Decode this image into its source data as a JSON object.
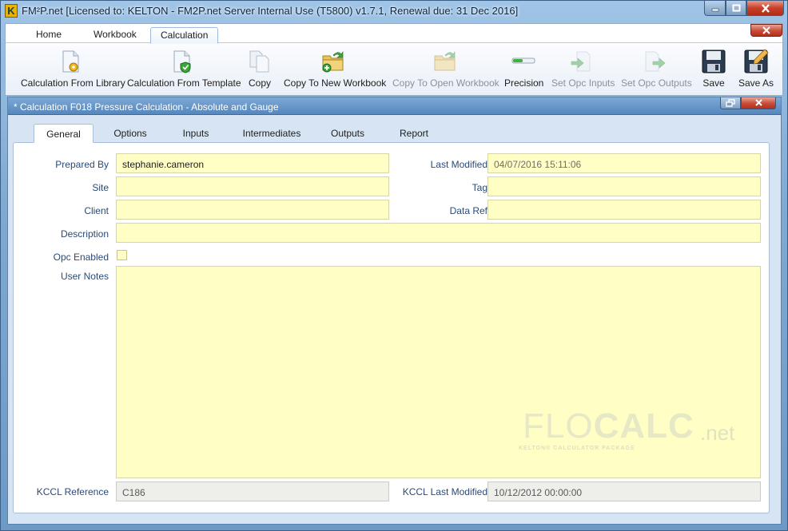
{
  "window": {
    "title": "FM²P.net [Licensed to: KELTON - FM2P.net Server Internal Use (T5800) v1.7.1, Renewal due: 31 Dec 2016]",
    "logo_letter": "K"
  },
  "ribbon": {
    "tabs": [
      "Home",
      "Workbook",
      "Calculation"
    ],
    "active_tab": "Calculation",
    "tools": [
      {
        "label": "Calculation From Library",
        "icon": "page-gear-icon",
        "enabled": true
      },
      {
        "label": "Calculation From Template",
        "icon": "page-check-icon",
        "enabled": true
      },
      {
        "label": "Copy",
        "icon": "copy-icon",
        "enabled": true
      },
      {
        "label": "Copy To New Workbook",
        "icon": "folder-add-icon",
        "enabled": true
      },
      {
        "label": "Copy To Open Workbook",
        "icon": "folder-arrow-icon",
        "enabled": false
      },
      {
        "label": "Precision",
        "icon": "precision-bar-icon",
        "enabled": true
      },
      {
        "label": "Set Opc Inputs",
        "icon": "opc-inputs-icon",
        "enabled": false
      },
      {
        "label": "Set Opc Outputs",
        "icon": "opc-outputs-icon",
        "enabled": false
      },
      {
        "label": "Save",
        "icon": "floppy-disk-icon",
        "enabled": true
      },
      {
        "label": "Save As",
        "icon": "floppy-disk-pencil-icon",
        "enabled": true
      }
    ]
  },
  "document": {
    "title": "* Calculation F018 Pressure Calculation - Absolute and Gauge",
    "tabs": [
      "General",
      "Options",
      "Inputs",
      "Intermediates",
      "Outputs",
      "Report"
    ],
    "active_tab": "General"
  },
  "general": {
    "prepared_by_label": "Prepared By",
    "prepared_by_value": "stephanie.cameron",
    "site_label": "Site",
    "site_value": "",
    "client_label": "Client",
    "client_value": "",
    "description_label": "Description",
    "description_value": "",
    "opc_enabled_label": "Opc Enabled",
    "opc_enabled_checked": false,
    "user_notes_label": "User Notes",
    "user_notes_value": "",
    "last_modified_label": "Last Modified",
    "last_modified_value": "04/07/2016 15:11:06",
    "tag_label": "Tag",
    "tag_value": "",
    "data_ref_label": "Data Ref",
    "data_ref_value": "",
    "kccl_reference_label": "KCCL Reference",
    "kccl_reference_value": "C186",
    "kccl_last_modified_label": "KCCL Last Modified",
    "kccl_last_modified_value": "10/12/2012 00:00:00"
  },
  "watermark": {
    "flo": "FLO",
    "calc": "CALC",
    "net": ".net",
    "subtitle": "KELTON® CALCULATOR PACKAGE"
  },
  "colors": {
    "field_bg": "#ffffc5",
    "accent": "#5687bd"
  }
}
